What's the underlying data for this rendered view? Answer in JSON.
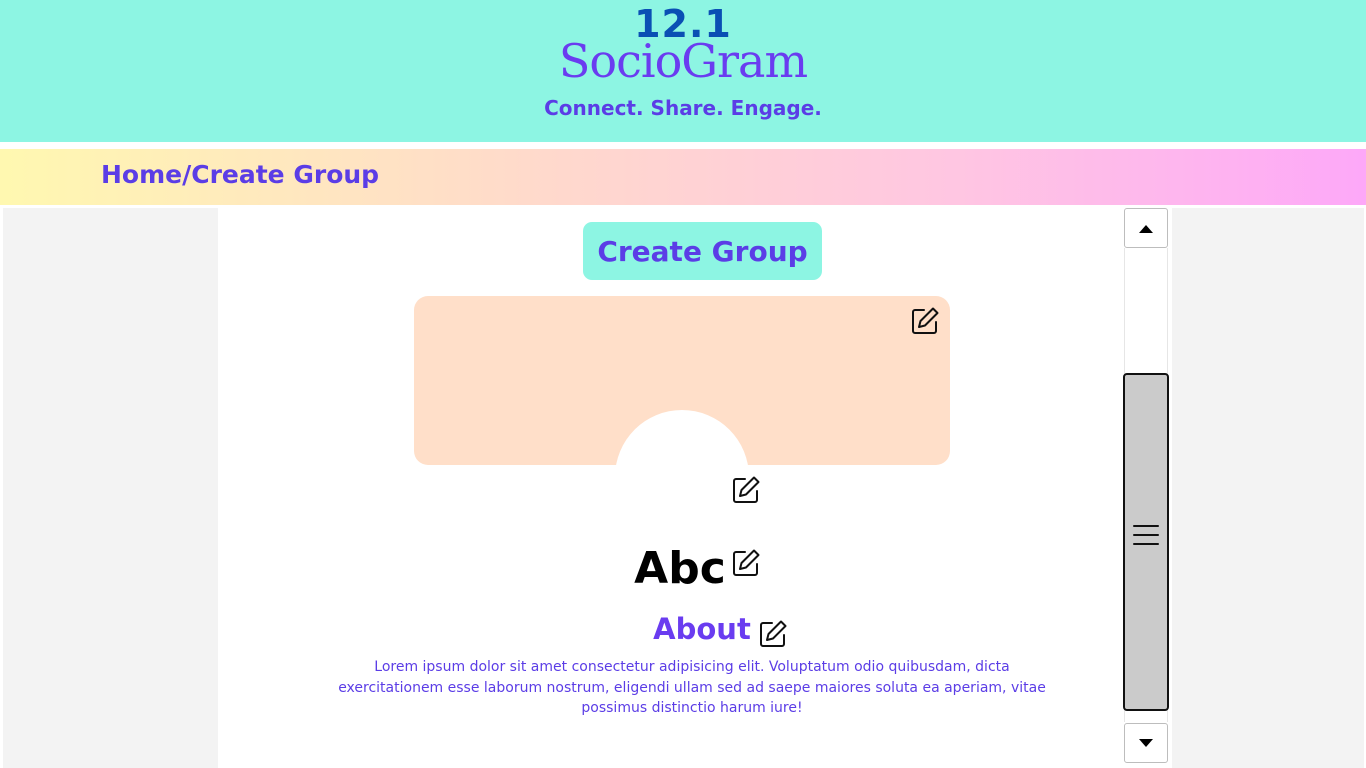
{
  "header": {
    "version": "12.1",
    "brand": "SocioGram",
    "tagline": "Connect. Share. Engage.",
    "background": "#8df5e3"
  },
  "breadcrumb": {
    "text": "Home/Create Group"
  },
  "main": {
    "create_button_label": "Create Group",
    "cover_color": "#ffdfc9",
    "group_name": "Abc",
    "about_title": "About",
    "about_text": "Lorem ipsum dolor sit amet consectetur adipisicing elit. Voluptatum odio quibusdam, dicta exercitationem esse laborum nostrum, eligendi ullam sed ad saepe maiores soluta ea aperiam, vitae possimus distinctio harum iure!"
  },
  "icons": {
    "edit": "edit-icon",
    "scroll_up": "arrow-up-icon",
    "scroll_down": "arrow-down-icon",
    "scroll_grip": "hamburger-icon"
  },
  "colors": {
    "accent": "#5b3de6",
    "brand": "#6a3cf0",
    "version": "#0a4fb4"
  }
}
